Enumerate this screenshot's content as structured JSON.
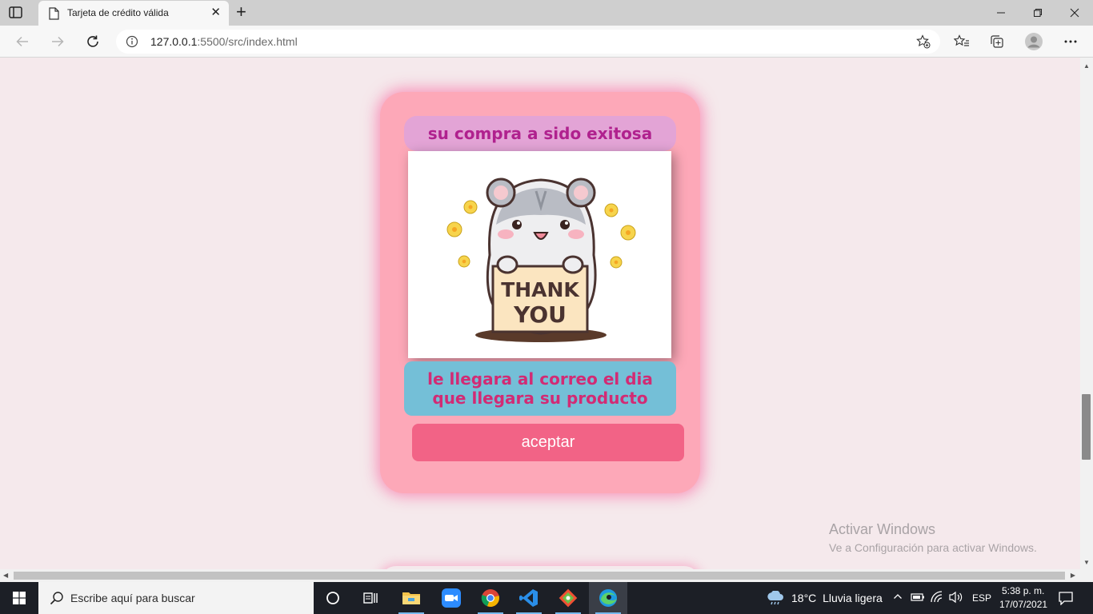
{
  "browser": {
    "tab_title": "Tarjeta de crédito válida",
    "url_host": "127.0.0.1",
    "url_rest": ":5500/src/index.html"
  },
  "card": {
    "title": "su compra a sido exitosa",
    "image_text": "THANK YOU",
    "message_line1": "le llegara al correo el dia",
    "message_line2": "que llegara su producto",
    "accept_label": "aceptar"
  },
  "watermark": {
    "title": "Activar Windows",
    "subtitle": "Ve a Configuración para activar Windows."
  },
  "taskbar": {
    "search_placeholder": "Escribe aquí para buscar",
    "weather_temp": "18°C",
    "weather_desc": "Lluvia ligera",
    "language": "ESP",
    "time": "5:38 p. m.",
    "date": "17/07/2021",
    "apps": [
      "task-view",
      "widgets",
      "file-explorer",
      "zoom",
      "chrome",
      "vscode",
      "git",
      "edge"
    ]
  },
  "colors": {
    "card_bg": "#fda8b8",
    "title_bg": "#e3a4d6",
    "title_text": "#b0218e",
    "message_bg": "#74bfd7",
    "message_text": "#d22b74",
    "button_bg": "#f26386",
    "page_bg": "#f5e9ec"
  }
}
